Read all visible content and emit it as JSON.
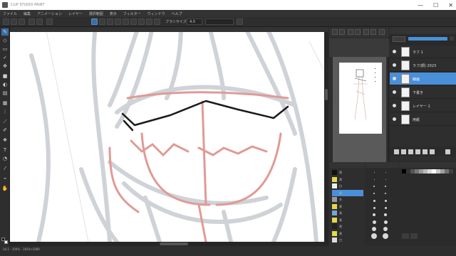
{
  "window": {
    "title": "CLIP STUDIO PAINT",
    "controls": [
      "—",
      "☐",
      "✕"
    ]
  },
  "menu": [
    "ファイル",
    "編集",
    "アニメーション",
    "レイヤー",
    "選択範囲",
    "表示",
    "フィルター",
    "ウィンドウ",
    "ヘルプ"
  ],
  "command_bar": {
    "brush_label": "ブラシサイズ",
    "size_value": "4.0"
  },
  "tools": [
    {
      "icon": "pen-icon"
    },
    {
      "icon": "eraser-icon"
    },
    {
      "icon": "selection-icon"
    },
    {
      "icon": "lasso-icon"
    },
    {
      "icon": "move-icon"
    },
    {
      "icon": "fill-icon"
    },
    {
      "icon": "gradient-icon"
    },
    {
      "icon": "figure-icon"
    },
    {
      "icon": "frame-icon"
    },
    {
      "icon": "ruler-icon"
    },
    {
      "icon": "text-icon"
    },
    {
      "icon": "balloon-icon"
    },
    {
      "icon": "correct-line-icon"
    },
    {
      "icon": "eyedropper-icon"
    },
    {
      "icon": "hand-icon"
    }
  ],
  "status": {
    "text": "34.1 · 100% · 1920×1080"
  },
  "layers": [
    {
      "name": "ラフ 1",
      "selected": false
    },
    {
      "name": "ラフ(顔) 2023",
      "selected": false
    },
    {
      "name": "線画",
      "selected": true
    },
    {
      "name": "下書き",
      "selected": false
    },
    {
      "name": "レイヤー 1",
      "selected": false
    },
    {
      "name": "用紙",
      "selected": false
    }
  ],
  "colorsets": [
    {
      "label": "黒",
      "color": "#111111",
      "selected": false
    },
    {
      "label": "黄",
      "color": "#e6d84a",
      "selected": false
    },
    {
      "label": "白",
      "color": "#eeeeee",
      "selected": false
    },
    {
      "label": "青",
      "color": "#4a8fd9",
      "selected": true
    },
    {
      "label": "灰",
      "color": "#999999",
      "selected": false
    },
    {
      "label": "黄",
      "color": "#e6d84a",
      "selected": false
    },
    {
      "label": "青",
      "color": "#6fa8dc",
      "selected": false
    },
    {
      "label": "黄",
      "color": "#e6d84a",
      "selected": false
    },
    {
      "label": "黒",
      "color": "#222222",
      "selected": false
    },
    {
      "label": "黄",
      "color": "#e6d84a",
      "selected": false
    },
    {
      "label": "白",
      "color": "#dddddd",
      "selected": false
    }
  ],
  "palette_colors": [
    "#000000",
    "#333333",
    "#555555",
    "#777777",
    "#999999",
    "#bbbbbb",
    "#dddddd",
    "#ffffff",
    "#c8c8c8",
    "#a0a0a0",
    "#707070",
    "#404040"
  ],
  "accent": "#4a8fd9"
}
